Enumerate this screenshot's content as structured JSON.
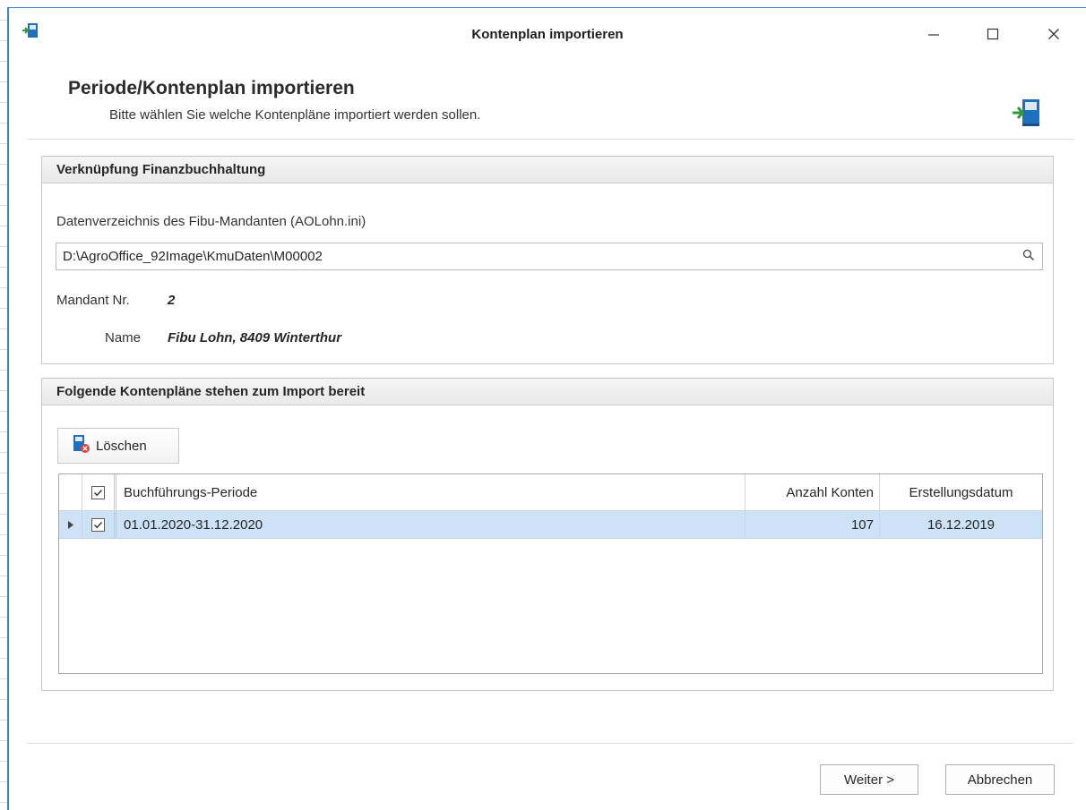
{
  "window": {
    "title": "Kontenplan importieren"
  },
  "header": {
    "title": "Periode/Kontenplan importieren",
    "subtitle": "Bitte wählen Sie welche Kontenpläne importiert werden sollen."
  },
  "link_group": {
    "title": "Verknüpfung Finanzbuchhaltung",
    "dir_label": "Datenverzeichnis des Fibu-Mandanten (AOLohn.ini)",
    "dir_value": "D:\\AgroOffice_92Image\\KmuDaten\\M00002",
    "mandant_label": "Mandant Nr.",
    "mandant_value": "2",
    "name_label": "Name",
    "name_value": "Fibu Lohn, 8409 Winterthur"
  },
  "import_group": {
    "title": "Folgende Kontenpläne stehen zum Import bereit",
    "delete_label": "Löschen",
    "columns": {
      "period": "Buchführungs-Periode",
      "count": "Anzahl Konten",
      "date": "Erstellungsdatum"
    },
    "rows": [
      {
        "period": "01.01.2020-31.12.2020",
        "count": "107",
        "date": "16.12.2019",
        "checked": true
      }
    ]
  },
  "footer": {
    "next_label": "Weiter >",
    "cancel_label": "Abbrechen"
  },
  "colors": {
    "accent": "#3c83d6",
    "selected_row": "#cde2f6",
    "icon_blue": "#1f6fbf",
    "icon_green": "#2e9b3a",
    "delete_badge": "#e0403a"
  },
  "icons": [
    "import-book-icon",
    "search-icon",
    "delete-book-icon",
    "checkbox-icon",
    "row-indicator-icon"
  ]
}
